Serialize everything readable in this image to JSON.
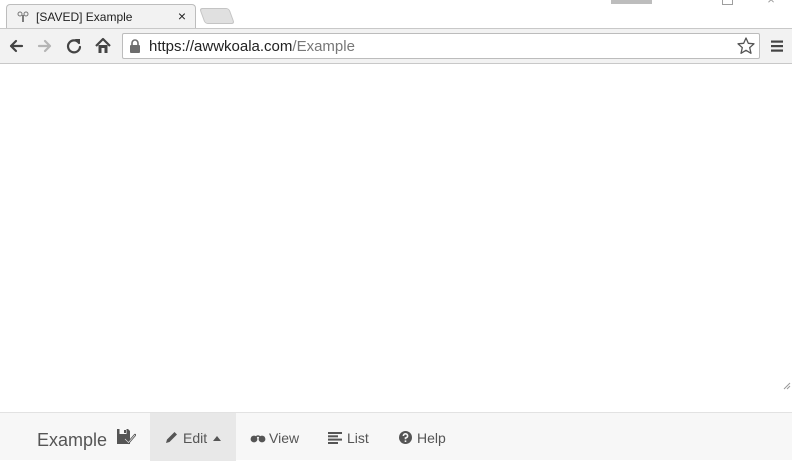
{
  "browser": {
    "tab_title": "[SAVED] Example",
    "tab_close": "×",
    "url_host": "https://awwkoala.com",
    "url_path": "/Example",
    "window_close": "×"
  },
  "bottombar": {
    "doc_title": "Example",
    "edit_label": "Edit",
    "view_label": "View",
    "list_label": "List",
    "help_label": "Help"
  }
}
